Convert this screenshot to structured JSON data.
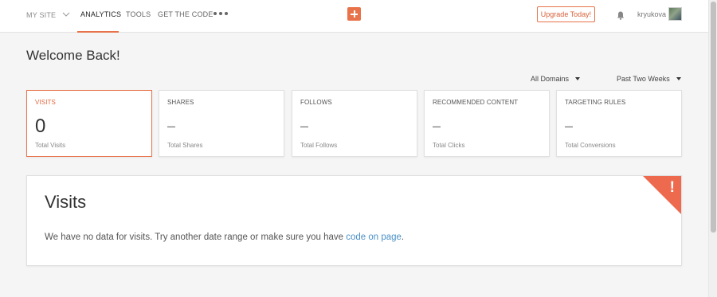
{
  "nav": {
    "my_site": "MY SITE",
    "analytics": "ANALYTICS",
    "tools": "TOOLS",
    "get_the_code": "GET THE CODE",
    "upgrade": "Upgrade Today!",
    "username": "kryukova"
  },
  "colors": {
    "accent": "#e8734a",
    "link": "#4a90c8",
    "alert": "#ee6a4f"
  },
  "welcome": "Welcome Back!",
  "filters": {
    "domains": "All Domains",
    "range": "Past Two Weeks"
  },
  "stats": [
    {
      "title": "VISITS",
      "value": "0",
      "sub": "Total Visits",
      "active": true
    },
    {
      "title": "SHARES",
      "value": "–",
      "sub": "Total Shares"
    },
    {
      "title": "FOLLOWS",
      "value": "–",
      "sub": "Total Follows"
    },
    {
      "title": "RECOMMENDED CONTENT",
      "value": "–",
      "sub": "Total Clicks"
    },
    {
      "title": "TARGETING RULES",
      "value": "–",
      "sub": "Total Conversions"
    }
  ],
  "visits_panel": {
    "title": "Visits",
    "message": "We have no data for visits. Try another date range or make sure you have ",
    "link": "code on page",
    "message_end": ".",
    "alert_mark": "!"
  }
}
